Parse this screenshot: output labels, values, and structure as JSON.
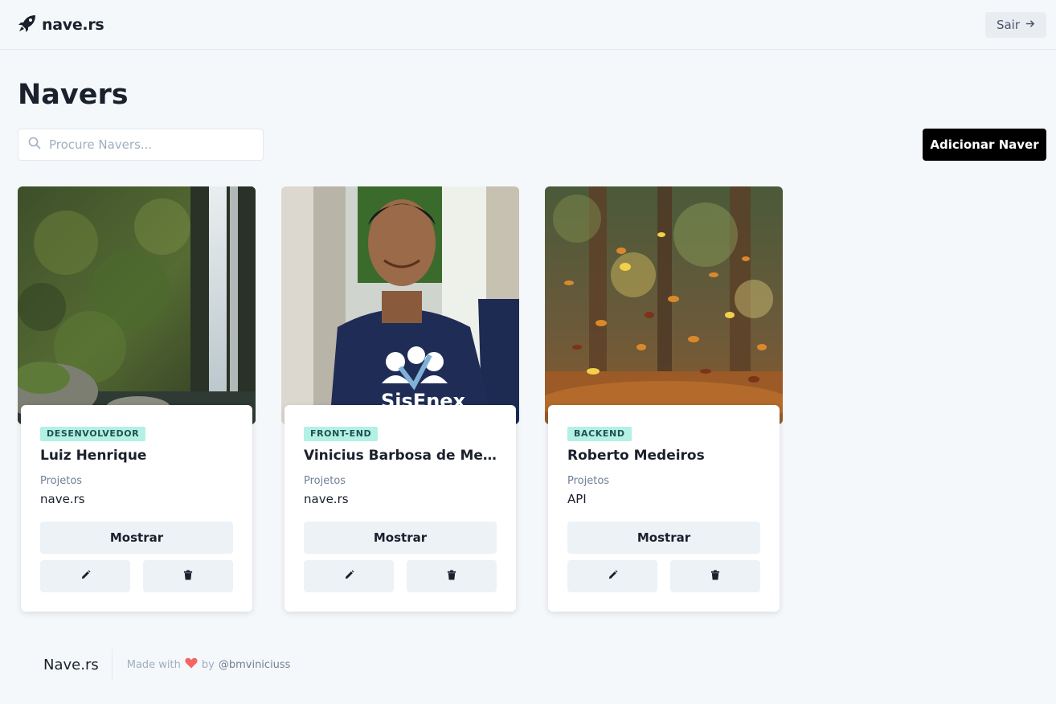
{
  "header": {
    "brand": "nave.rs",
    "logout_label": "Sair"
  },
  "page": {
    "title": "Navers",
    "search_placeholder": "Procure Navers...",
    "add_label": "Adicionar Naver"
  },
  "cards": [
    {
      "role": "DESENVOLVEDOR",
      "name": "Luiz Henrique",
      "projects_label": "Projetos",
      "projects": "nave.rs",
      "show_label": "Mostrar",
      "photo": "waterfall-photo"
    },
    {
      "role": "FRONT-END",
      "name": "Vinicius Barbosa de Medeiros",
      "projects_label": "Projetos",
      "projects": "nave.rs",
      "show_label": "Mostrar",
      "photo": "portrait-photo"
    },
    {
      "role": "BACKEND",
      "name": "Roberto Medeiros",
      "projects_label": "Projetos",
      "projects": "API",
      "show_label": "Mostrar",
      "photo": "autumn-leaves-photo"
    }
  ],
  "footer": {
    "brand": "Nave.rs",
    "made_with": "Made with",
    "by": "by",
    "handle": "@bmviniciuss"
  },
  "colors": {
    "badge_bg": "#b2f1e3",
    "primary_button": "#000000",
    "heart": "#f56565"
  }
}
